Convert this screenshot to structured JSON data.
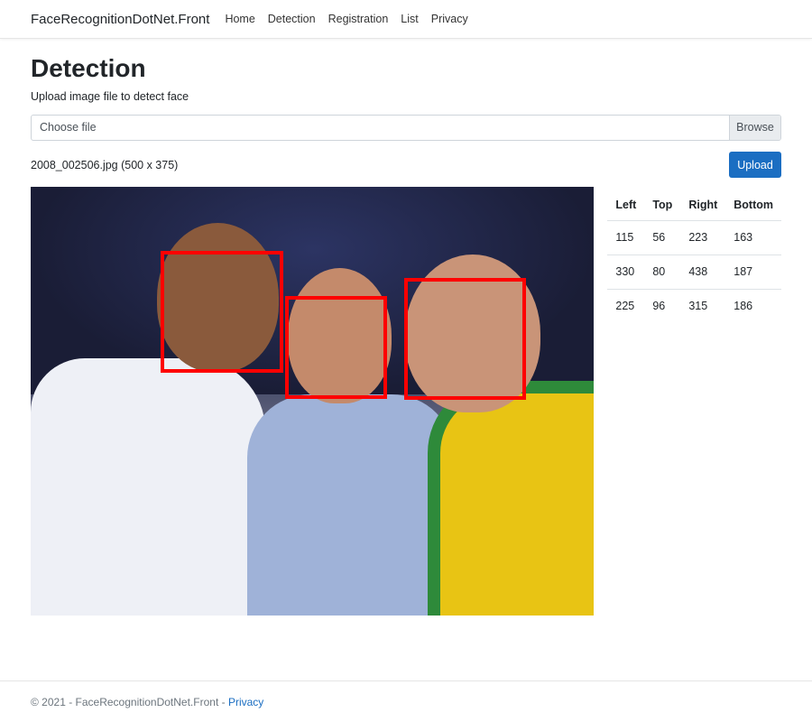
{
  "navbar": {
    "brand": "FaceRecognitionDotNet.Front",
    "links": [
      "Home",
      "Detection",
      "Registration",
      "List",
      "Privacy"
    ]
  },
  "page": {
    "title": "Detection",
    "subtitle": "Upload image file to detect face"
  },
  "file_input": {
    "placeholder": "Choose file",
    "browse_label": "Browse"
  },
  "file_info": "2008_002506.jpg (500 x 375)",
  "upload_label": "Upload",
  "table": {
    "headers": [
      "Left",
      "Top",
      "Right",
      "Bottom"
    ],
    "rows": [
      [
        "115",
        "56",
        "223",
        "163"
      ],
      [
        "330",
        "80",
        "438",
        "187"
      ],
      [
        "225",
        "96",
        "315",
        "186"
      ]
    ]
  },
  "footer": {
    "text": "© 2021 - FaceRecognitionDotNet.Front - ",
    "link": "Privacy"
  },
  "colors": {
    "accent": "#1b6ec2",
    "face_box": "#ff0000"
  }
}
